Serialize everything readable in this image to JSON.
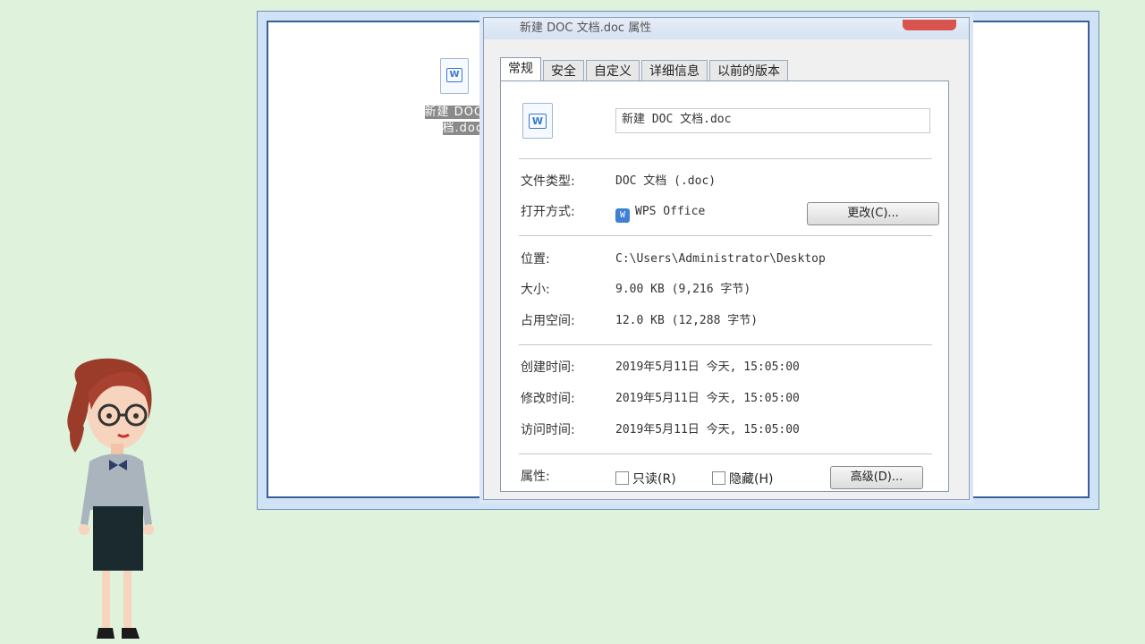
{
  "desktop": {
    "file_label_line1": "新建 DOC",
    "file_label_line2": "档.doc"
  },
  "dialog": {
    "title": "新建 DOC 文档.doc 属性",
    "tabs": [
      "常规",
      "安全",
      "自定义",
      "详细信息",
      "以前的版本"
    ],
    "file_name": "新建 DOC 文档.doc",
    "file_type_label": "文件类型:",
    "file_type_value": "DOC 文档 (.doc)",
    "open_with_label": "打开方式:",
    "open_with_value": "WPS Office",
    "change_button": "更改(C)...",
    "location_label": "位置:",
    "location_value": "C:\\Users\\Administrator\\Desktop",
    "size_label": "大小:",
    "size_value": "9.00 KB (9,216 字节)",
    "disk_size_label": "占用空间:",
    "disk_size_value": "12.0 KB (12,288 字节)",
    "created_label": "创建时间:",
    "created_value": "2019年5月11日 今天, 15:05:00",
    "modified_label": "修改时间:",
    "modified_value": "2019年5月11日 今天, 15:05:00",
    "accessed_label": "访问时间:",
    "accessed_value": "2019年5月11日 今天, 15:05:00",
    "attributes_label": "属性:",
    "readonly_label": "只读(R)",
    "hidden_label": "隐藏(H)",
    "advanced_button": "高级(D)..."
  },
  "icons": {
    "doc": "W",
    "wps": "W"
  }
}
